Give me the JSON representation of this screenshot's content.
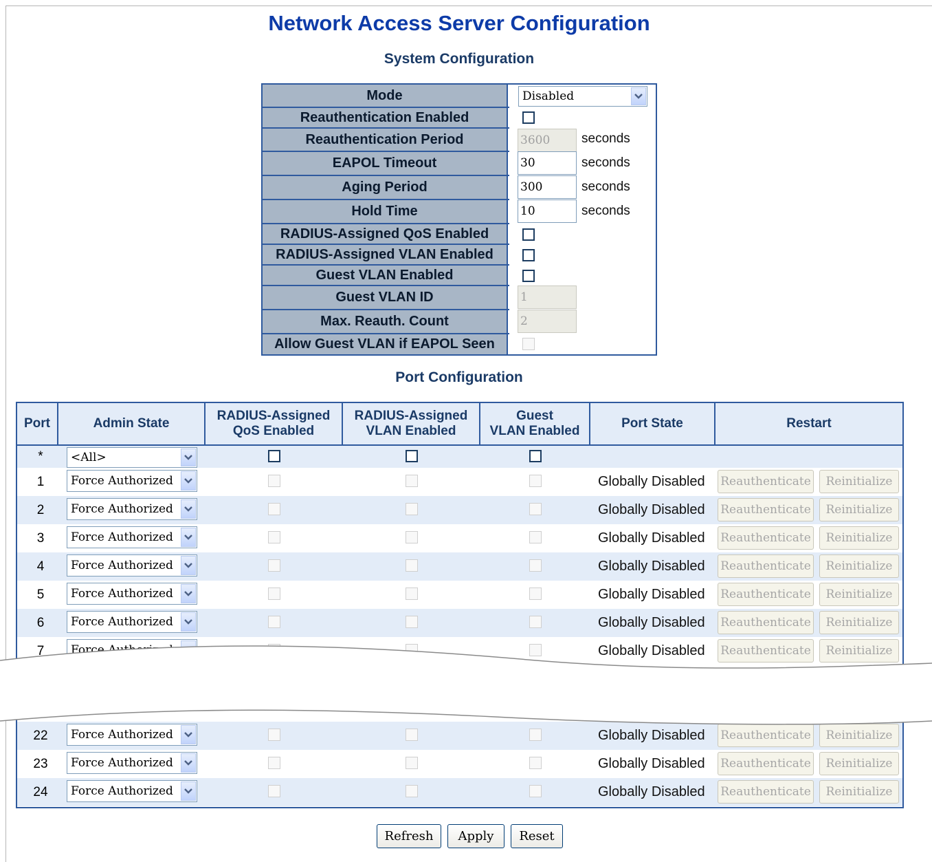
{
  "page": {
    "title": "Network Access Server Configuration",
    "system_section": "System Configuration",
    "port_section": "Port Configuration"
  },
  "system": {
    "mode_label": "Mode",
    "mode_value": "Disabled",
    "reauth_enabled_label": "Reauthentication Enabled",
    "reauth_enabled": false,
    "reauth_period_label": "Reauthentication Period",
    "reauth_period": "3600",
    "eapol_timeout_label": "EAPOL Timeout",
    "eapol_timeout": "30",
    "aging_period_label": "Aging Period",
    "aging_period": "300",
    "hold_time_label": "Hold Time",
    "hold_time": "10",
    "radius_qos_label": "RADIUS-Assigned QoS Enabled",
    "radius_vlan_label": "RADIUS-Assigned VLAN Enabled",
    "guest_vlan_enabled_label": "Guest VLAN Enabled",
    "guest_vlan_id_label": "Guest VLAN ID",
    "guest_vlan_id": "1",
    "max_reauth_label": "Max. Reauth. Count",
    "max_reauth": "2",
    "allow_guest_label": "Allow Guest VLAN if EAPOL Seen",
    "seconds": "seconds"
  },
  "port_table": {
    "headers": {
      "port": "Port",
      "admin_state": "Admin State",
      "qos_1": "RADIUS-Assigned",
      "qos_2": "QoS Enabled",
      "vlan_1": "RADIUS-Assigned",
      "vlan_2": "VLAN Enabled",
      "guest_1": "Guest",
      "guest_2": "VLAN Enabled",
      "port_state": "Port State",
      "restart": "Restart"
    },
    "all_row": {
      "port": "*",
      "admin_state": "<All>"
    },
    "rows": [
      {
        "port": "1",
        "admin_state": "Force Authorized",
        "port_state": "Globally Disabled"
      },
      {
        "port": "2",
        "admin_state": "Force Authorized",
        "port_state": "Globally Disabled"
      },
      {
        "port": "3",
        "admin_state": "Force Authorized",
        "port_state": "Globally Disabled"
      },
      {
        "port": "4",
        "admin_state": "Force Authorized",
        "port_state": "Globally Disabled"
      },
      {
        "port": "5",
        "admin_state": "Force Authorized",
        "port_state": "Globally Disabled"
      },
      {
        "port": "6",
        "admin_state": "Force Authorized",
        "port_state": "Globally Disabled"
      },
      {
        "port": "7",
        "admin_state": "Force Authorized",
        "port_state": "Globally Disabled"
      },
      {
        "port": "22",
        "admin_state": "Force Authorized",
        "port_state": "Globally Disabled"
      },
      {
        "port": "23",
        "admin_state": "Force Authorized",
        "port_state": "Globally Disabled"
      },
      {
        "port": "24",
        "admin_state": "Force Authorized",
        "port_state": "Globally Disabled"
      }
    ],
    "reauthenticate_label": "Reauthenticate",
    "reinitialize_label": "Reinitialize"
  },
  "buttons": {
    "refresh": "Refresh",
    "apply": "Apply",
    "reset": "Reset"
  },
  "colors": {
    "title": "#0d3ba8",
    "border": "#2f5a9e",
    "label_bg": "#a8b6c6",
    "row_alt": "#e3ecf8"
  }
}
